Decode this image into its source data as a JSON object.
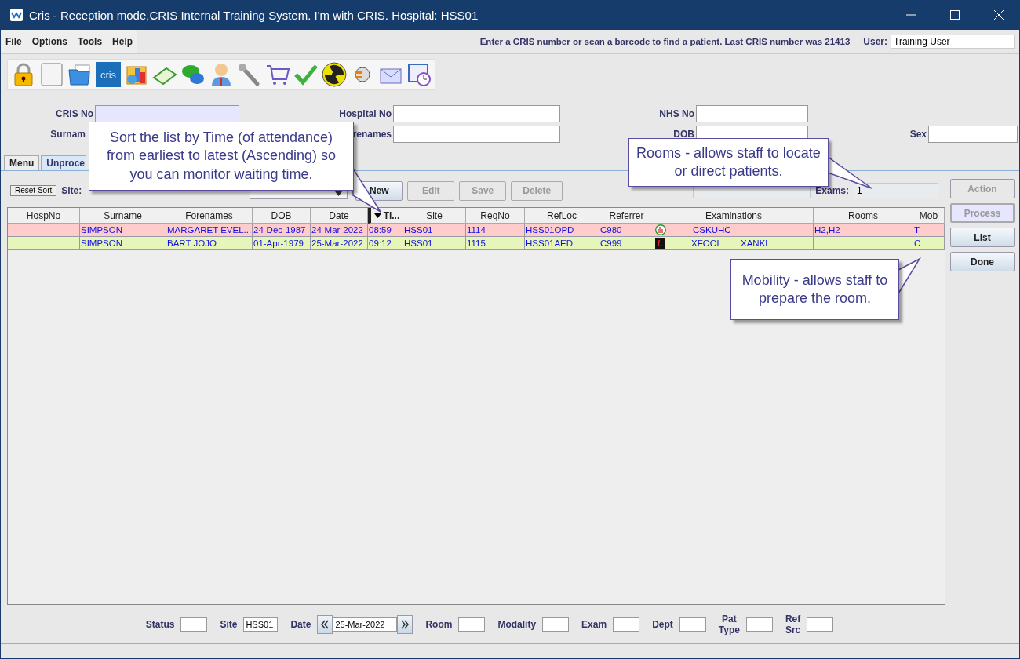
{
  "window": {
    "title": "Cris - Reception mode,CRIS Internal Training System. I'm with CRIS.   Hospital: HSS01"
  },
  "menu": [
    {
      "label": "File"
    },
    {
      "label": "Options"
    },
    {
      "label": "Tools"
    },
    {
      "label": "Help"
    }
  ],
  "message": "Enter a CRIS number or scan a barcode to find a patient. Last CRIS number was 21413",
  "user": {
    "label": "User:",
    "value": "Training User"
  },
  "toolbar": [
    {
      "kind": "lock"
    },
    {
      "kind": "blank"
    },
    {
      "kind": "folder"
    },
    {
      "kind": "cris",
      "text": "cris"
    },
    {
      "kind": "chart"
    },
    {
      "kind": "book"
    },
    {
      "kind": "chat"
    },
    {
      "kind": "person"
    },
    {
      "kind": "wrench"
    },
    {
      "kind": "cart"
    },
    {
      "kind": "check"
    },
    {
      "kind": "radiation"
    },
    {
      "kind": "plug"
    },
    {
      "kind": "envelope"
    },
    {
      "kind": "clock"
    }
  ],
  "search": {
    "cris_no": "CRIS No",
    "surname": "Surnam",
    "hospital_no": "Hospital No",
    "forenames": "renames",
    "nhs_no": "NHS No",
    "dob": "DOB",
    "sex": "Sex"
  },
  "tabs": [
    {
      "label": "Menu",
      "selected": false
    },
    {
      "label": "Unproce",
      "selected": true
    }
  ],
  "actions": {
    "reset": "Reset Sort",
    "site": "Site:",
    "buttons": [
      {
        "label": "New",
        "disabled": false
      },
      {
        "label": "Edit",
        "disabled": true
      },
      {
        "label": "Save",
        "disabled": true
      },
      {
        "label": "Delete",
        "disabled": true
      }
    ],
    "exams_label": "Exams:",
    "exams_value": "1"
  },
  "side_buttons": [
    {
      "label": "Action",
      "disabled": true
    },
    {
      "label": "Process",
      "disabled": true
    },
    {
      "label": "List",
      "disabled": false
    },
    {
      "label": "Done",
      "disabled": false
    }
  ],
  "table": {
    "columns": [
      {
        "label": "HospNo",
        "sorted": false
      },
      {
        "label": "Surname",
        "sorted": false
      },
      {
        "label": "Forenames",
        "sorted": false
      },
      {
        "label": "DOB",
        "sorted": false
      },
      {
        "label": "Date",
        "sorted": false
      },
      {
        "label": "Ti...",
        "sorted": true
      },
      {
        "label": "Site",
        "sorted": false
      },
      {
        "label": "ReqNo",
        "sorted": false
      },
      {
        "label": "RefLoc",
        "sorted": false
      },
      {
        "label": "Referrer",
        "sorted": false
      },
      {
        "label": "Examinations",
        "sorted": false
      },
      {
        "label": "Rooms",
        "sorted": false
      },
      {
        "label": "Mob",
        "sorted": false
      }
    ],
    "rows": [
      {
        "color": "#ffcccc",
        "kind": "thumb",
        "cells": [
          "",
          "SIMPSON",
          "MARGARET EVEL...",
          "24-Dec-1987",
          "24-Mar-2022",
          "08:59",
          "HSS01",
          "1114",
          "HSS01OPD",
          "C980"
        ],
        "exams": [
          "CSKUHC"
        ],
        "rooms": "H2,H2",
        "mob": "T"
      },
      {
        "color": "#e6f5b9",
        "kind": "letter",
        "exam_letter": "L",
        "cells": [
          "",
          "SIMPSON",
          "BART JOJO",
          "01-Apr-1979",
          "25-Mar-2022",
          "09:12",
          "HSS01",
          "1115",
          "HSS01AED",
          "C999"
        ],
        "exams": [
          "XFOOL",
          "XANKL"
        ],
        "rooms": "",
        "mob": "C"
      }
    ]
  },
  "filters": [
    {
      "label": "Status"
    },
    {
      "label": "Site",
      "value": "HSS01"
    },
    {
      "label": "Date",
      "value": "25-Mar-2022",
      "kind": "date"
    },
    {
      "label": "Room"
    },
    {
      "label": "Modality"
    },
    {
      "label": "Exam"
    },
    {
      "label": "Dept"
    },
    {
      "label": "Pat Type"
    },
    {
      "label": "Ref Src"
    }
  ],
  "callouts": [
    {
      "text": "Sort the list by Time (of attendance) from earliest to latest (Ascending) so you can monitor waiting time."
    },
    {
      "text": "Rooms - allows staff to locate or direct patients."
    },
    {
      "text": "Mobility - allows staff to prepare the room."
    }
  ]
}
